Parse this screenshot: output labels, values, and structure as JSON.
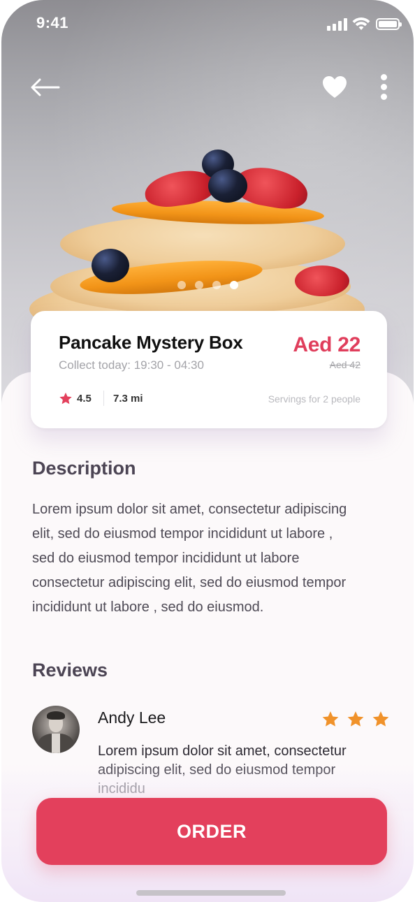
{
  "status_bar": {
    "time": "9:41"
  },
  "product": {
    "title": "Pancake Mystery Box",
    "collect": "Collect today: 19:30 - 04:30",
    "price": "Aed 22",
    "old_price": "Aed 42",
    "rating": "4.5",
    "distance": "7.3 mi",
    "servings": "Servings for 2 people"
  },
  "carousel": {
    "count": 4,
    "active_index": 3
  },
  "description": {
    "heading": "Description",
    "lines": [
      "Lorem ipsum dolor sit amet, consectetur adipiscing",
      "elit, sed do eiusmod tempor incididunt ut labore ,",
      "sed do eiusmod tempor incididunt ut labore",
      "consectetur adipiscing elit, sed do eiusmod tempor",
      "incididunt ut labore , sed do eiusmod."
    ]
  },
  "reviews": {
    "heading": "Reviews",
    "items": [
      {
        "name": "Andy Lee",
        "stars": 3,
        "lines": [
          "Lorem ipsum dolor sit amet, consectetur",
          "adipiscing elit, sed do eiusmod tempor",
          "incididu"
        ]
      }
    ]
  },
  "actions": {
    "order_label": "ORDER"
  },
  "icons": {
    "back": "arrow-left-icon",
    "favorite": "heart-icon",
    "more": "more-vertical-icon",
    "rating": "star-icon",
    "signal": "signal-icon",
    "wifi": "wifi-icon",
    "battery": "battery-icon"
  },
  "colors": {
    "accent": "#e3405c",
    "price": "#e03e5c",
    "rating_star": "#e3405c",
    "review_star": "#f0922a",
    "heading": "#4c4554"
  }
}
